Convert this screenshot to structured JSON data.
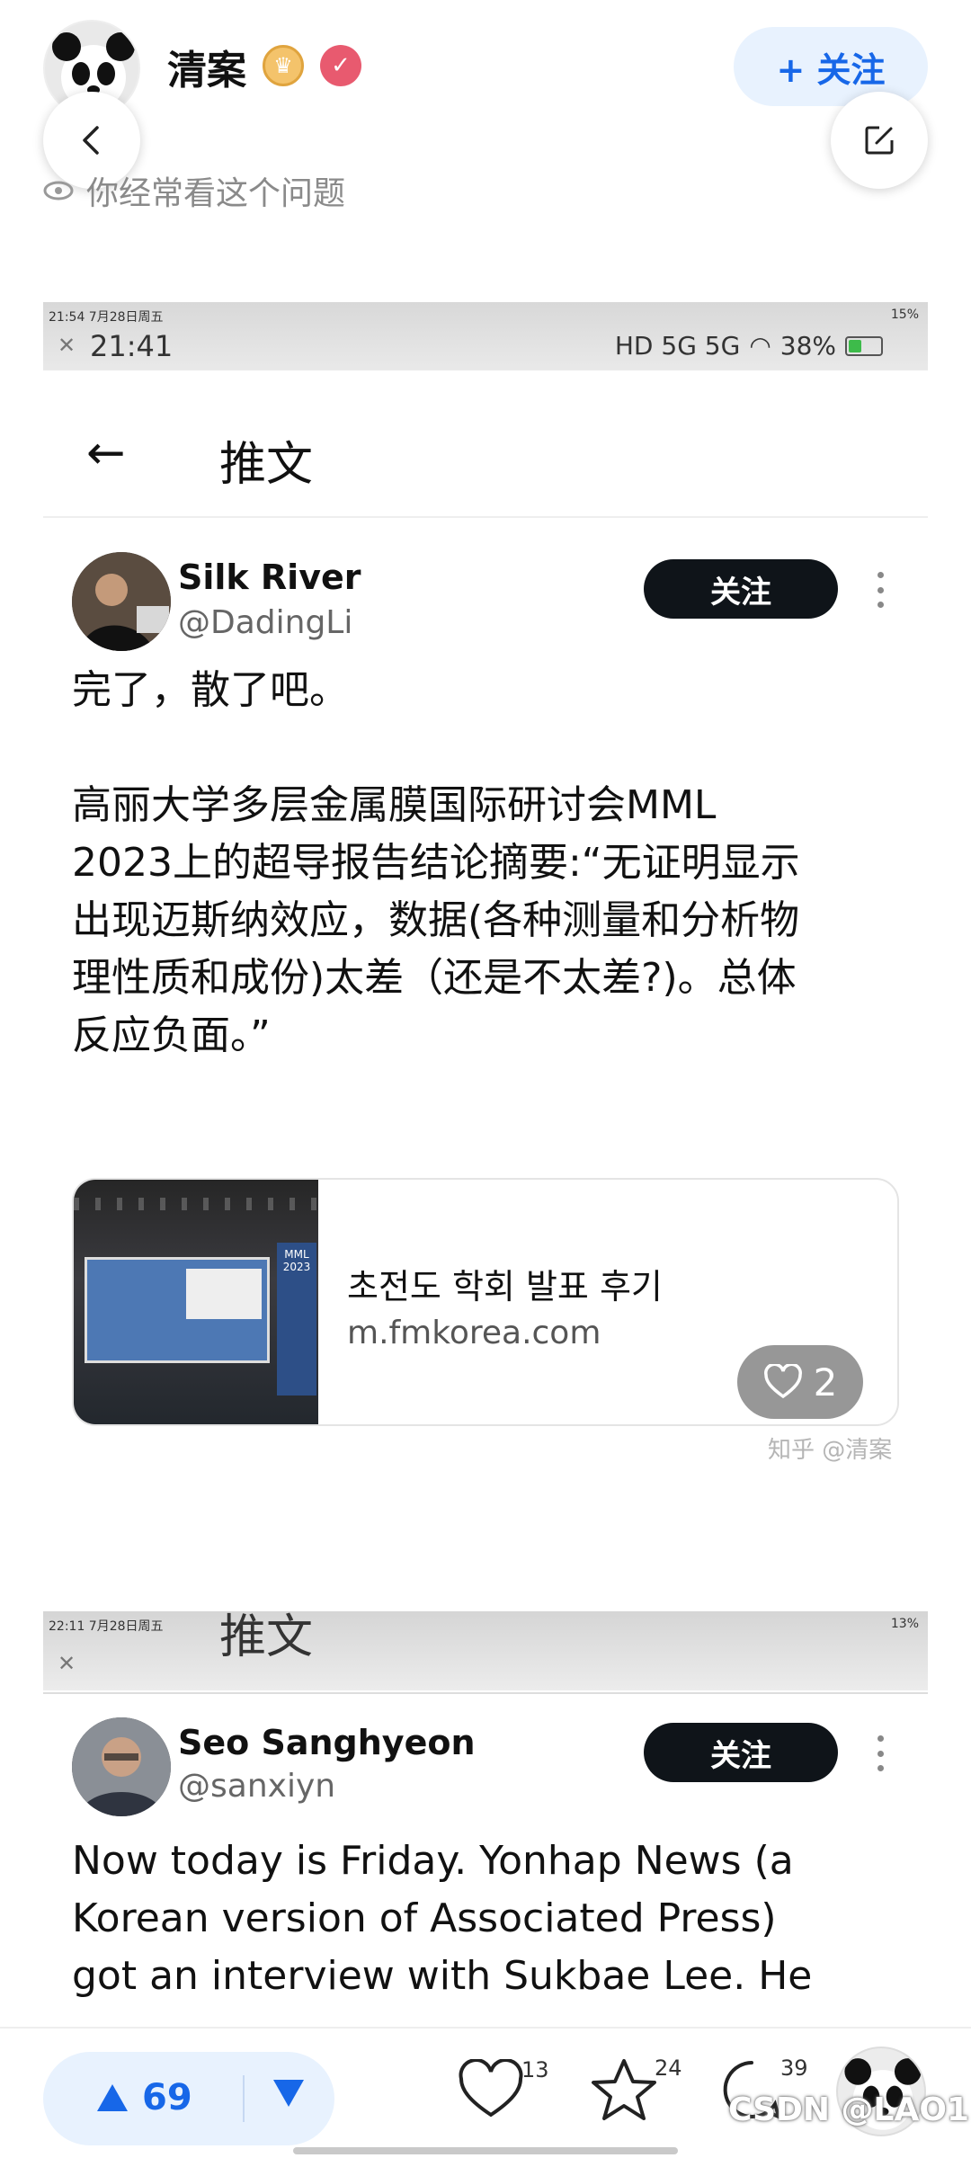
{
  "header": {
    "author_name": "清案",
    "follow_label": "+ 关注",
    "often_view": "你经常看这个问题"
  },
  "shot1": {
    "tiny_status_left": "21:54  7月28日周五",
    "tiny_status_right": "15%",
    "status_time": "21:41",
    "status_right": "38%",
    "page_title": "推文",
    "tweet": {
      "name": "Silk River",
      "handle": "@DadingLi",
      "follow_label": "关注",
      "lines": [
        "完了，散了吧。",
        "",
        "高丽大学多层金属膜国际研讨会MML",
        "2023上的超导报告结论摘要:“无证明显示",
        "出现迈斯纳效应，数据(各种测量和分析物",
        "理性质和成份)太差（还是不太差?)。总体",
        "反应负面。”"
      ]
    },
    "card": {
      "title": "초전도 학회 발표 후기",
      "url": "m.fmkorea.com",
      "banner": "MML 2023"
    },
    "like_count": "2",
    "watermark": "知乎 @清案"
  },
  "shot2": {
    "tiny_status_left": "22:11  7月28日周五",
    "tiny_status_right": "13%",
    "page_title": "推文",
    "tweet": {
      "name": "Seo Sanghyeon",
      "handle": "@sanxiyn",
      "follow_label": "关注",
      "lines": [
        "Now today is Friday. Yonhap News (a",
        "Korean version of Associated Press)",
        "got an interview with Sukbae Lee. He"
      ]
    }
  },
  "bottom": {
    "upvotes": "69",
    "likes": "13",
    "stars": "24",
    "comments": "39",
    "overlay_text": "CSDN @LAO1"
  },
  "colors": {
    "accent": "#1767e8",
    "follow_bg": "#0f1419",
    "pill_bg": "#e8f2fe"
  },
  "icons": [
    "back-arrow-icon",
    "edit-icon",
    "eye-icon",
    "more-dots-icon",
    "heart-icon",
    "star-icon",
    "comment-icon",
    "upvote-icon",
    "downvote-icon",
    "wifi-icon",
    "battery-icon"
  ]
}
